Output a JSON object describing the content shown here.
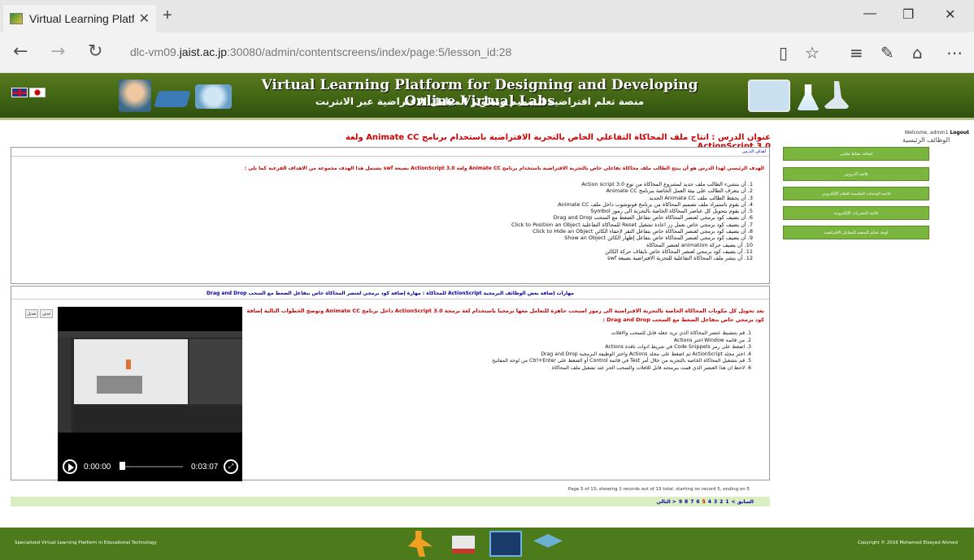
{
  "browser": {
    "tab_title": "Virtual Learning Platforr",
    "url_prefix": "dlc-vm09.",
    "url_domain": "jaist.ac.jp",
    "url_suffix": ":30080/admin/contentscreens/index/page:5/lesson_id:28"
  },
  "banner": {
    "title": "Virtual Learning Platform for Designing and Developing Online Virtual Labs",
    "subtitle": "منصة تعلم افتراضية لتصميم وتطوير المعامل الافتراضية عبر الانترنت"
  },
  "welcome": {
    "text": "Welcome, admin1",
    "logout": "Logout"
  },
  "sidebar": {
    "title": "الوظائف الرئيسية",
    "items": [
      "إضافة نشاط تعلمي",
      "قائمة الدروس",
      "قائمة الوحدات التعليمية للتعلم الإلكتروني",
      "قائمة المقررات الإلكترونية",
      "لوحة تحكم المنصة للمعامل الافتراضية"
    ]
  },
  "lesson": {
    "title": "عنوان الدرس : انتاج ملف المحاكاة التفاعلي الخاص بالتجربة الافتراضية باستخدام برنامج Animate CC ولغة ActionScript 3.0"
  },
  "objectives": {
    "header": "أهداف الدرس",
    "goal": "الهدف الرئيسي لهذا الدرس هو أن ينتج الطالب ملف محاكاة تفاعلي خاص بالتجربة الافتراضية باستخدام برنامج Animate CC ولغة ActionScript 3.0 بصيغة swf يشتمل هذا الهدف مجموعة من الاهداف الفرعية كما يلي :",
    "items": [
      "1. أن ينشيء الطالب ملف جديد لمشروع المحاكاة من نوع Action script 3.0",
      "2. أن يتعرف الطالب على بيئة العمل الخاصة ببرنامج Animate CC",
      "3. أن يحفظ الطالب ملف Animate CC الجديد",
      "4. أن يقوم باستيراد ملف تصميم المحاكاة من برنامج فوتوشوب داخل ملف Animate CC",
      "5. أن يقوم بتحويل كل عناصر المحاكاة الخاصة بالتجربة الى رموز Symbol",
      "6. أن يضيف كود برمجي لعنصر المحاكاة خاص بتفاعل الضغط مع السحب Drag and Drop",
      "7. أن يضيف كود برمجي خاص بعمل زر اعادة تشغيل Reset للمحاكاة التفاعلية Click to Position an Object",
      "8. أن يضيف كود برمجي لعنصر المحاكاة خاص بتفاعل النقر لإخفاء الكائن Click to Hide an Object",
      "9. أن يضيف كود برمجي لعنصر المحاكاة خاص بتفاعل إظهار الكائن Show an Object",
      "10. أن يضيف حركة animation لعنصر المحاكاة",
      "11. أن يضيف كود برمجي لعنصر المحاكاة خاص بايقاف حركة الكائن",
      "12. أن ينشر ملف المحاكاة التفاعلية للتجربة الافتراضية بصيغة swf"
    ]
  },
  "skill": {
    "header": "مهارات إضافة بعض الوظائف البرمجية ActionScript للمحاكاة : مهارة إضافة كود برمجي لعنصر المحاكاة خاص بتفاعل الضغط مع السحب Drag and Drop",
    "edit_label": "تعديل",
    "delete_label": "حذف",
    "intro": "بعد تحويل كل مكونات المحاكاة الخاصة بالتجربة الافتراضية الى رموز اصبحت جاهزة للتعامل معها برمجيا باستخدام لغة برمجة ActionScript 3.0 داخل برنامج Animate CC وتوضح الخطوات التالية إضافة كود برمجي خاص بتفاعل الضغط مع السحب Drag and Drop :",
    "steps": [
      "1. قم بتنشيط عنصر المحاكاة الذي تريد جعله قابل للسحب والافلات",
      "2. من قائمة Window اختر Actions",
      "3. اضغط على رمز Code Snippets في شريط ادوات نافذة Actions",
      "4. اختر مجلد ActionScript ثم اضغط على مجلد Actions واختر الوظيفة البرمجية Drag and Drop",
      "5. قم بتشغيل المحاكاة الخاصة بالتجربة من خلال أمر Test في قائمة Control أو الضغط على Ctrl+Enter من لوحة المفاتيح",
      "6. لاحظ ان هذا العنصر الذي قمت ببرمجته قابل للافلات والسحب الحر عند تشغيل ملف المحاكاة"
    ]
  },
  "video": {
    "current_time": "0:00:00",
    "duration": "0:03:07",
    "progress": 0
  },
  "pagination": {
    "info": "Page 5 of 13, showing 1 records out of 13 total, starting on record 5, ending on 5",
    "prev": "< السابق",
    "next": "التالي >",
    "pages": [
      "1",
      "2",
      "3",
      "4",
      "5",
      "6",
      "7",
      "8",
      "9"
    ],
    "current": "5"
  },
  "footer": {
    "left": "Specialized Virtual Learning Platform in Educational Technology",
    "right": "Copyright © 2016 Mohamed Elsayed Ahmed"
  }
}
